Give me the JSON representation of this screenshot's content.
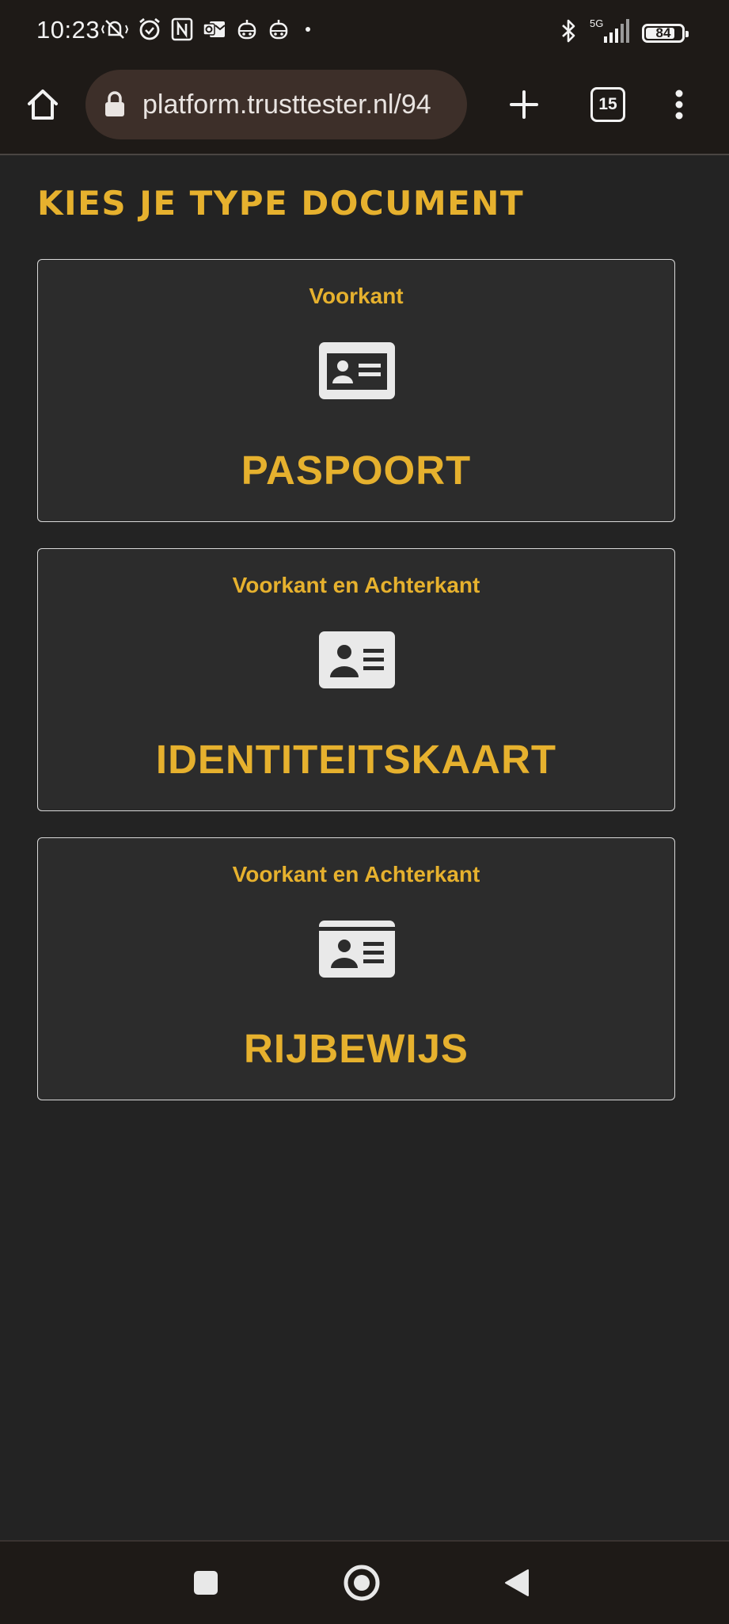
{
  "status_bar": {
    "time": "10:23",
    "network": "5G",
    "battery_percent": "84",
    "battery_level": 0.84,
    "left_icons": [
      "mute-vibrate-icon",
      "alarm-icon",
      "nfc-icon",
      "outlook-icon",
      "robot-app-icon",
      "robot-app-icon",
      "dot-icon"
    ],
    "right_icons": [
      "bluetooth-icon",
      "signal-icon",
      "battery-icon"
    ]
  },
  "browser": {
    "url": "platform.trusttester.nl/94",
    "tab_count": "15",
    "icons": {
      "home": "home-icon",
      "lock": "lock-icon",
      "new_tab": "plus-icon",
      "menu": "more-vertical-icon"
    }
  },
  "page": {
    "title": "KIES JE TYPE DOCUMENT",
    "documents": [
      {
        "subtitle": "Voorkant",
        "title": "PASPOORT",
        "icon": "id-card-icon"
      },
      {
        "subtitle": "Voorkant en Achterkant",
        "title": "IDENTITEITSKAART",
        "icon": "id-card-icon"
      },
      {
        "subtitle": "Voorkant en Achterkant",
        "title": "RIJBEWIJS",
        "icon": "id-card-icon"
      }
    ]
  },
  "nav_bar": {
    "buttons": [
      "recent-apps-icon",
      "home-circle-icon",
      "back-icon"
    ]
  },
  "colors": {
    "accent": "#e6b12e",
    "page_background": "#232323",
    "card_background": "#2c2c2c",
    "chrome_background": "#1e1a17",
    "url_bar_background": "#3d2f29"
  }
}
